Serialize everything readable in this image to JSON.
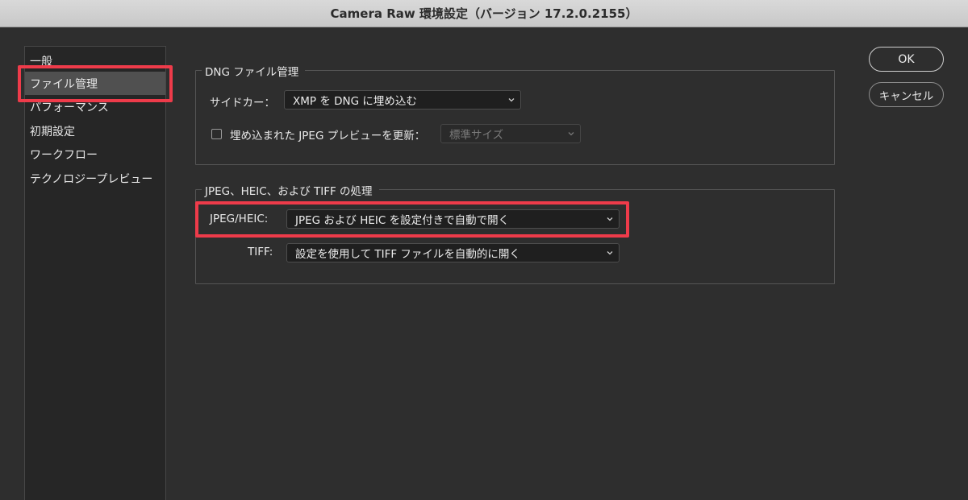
{
  "window": {
    "title": "Camera Raw 環境設定（バージョン 17.2.0.2155）"
  },
  "sidebar": {
    "items": [
      {
        "label": "一般"
      },
      {
        "label": "ファイル管理"
      },
      {
        "label": "パフォーマンス"
      },
      {
        "label": "初期設定"
      },
      {
        "label": "ワークフロー"
      },
      {
        "label": "テクノロジープレビュー"
      }
    ],
    "selected": "ファイル管理"
  },
  "dng": {
    "title": "DNG ファイル管理",
    "sidecar_label": "サイドカー：",
    "sidecar_value": "XMP を DNG に埋め込む",
    "update_preview_label": "埋め込まれた JPEG プレビューを更新：",
    "update_preview_checked": false,
    "preview_size_value": "標準サイズ"
  },
  "jpeg": {
    "title": "JPEG、HEIC、および TIFF の処理",
    "jpeg_heic_label": "JPEG/HEIC:",
    "jpeg_heic_value": "JPEG および HEIC を設定付きで自動で開く",
    "tiff_label": "TIFF:",
    "tiff_value": "設定を使用して TIFF ファイルを自動的に開く"
  },
  "buttons": {
    "ok": "OK",
    "cancel": "キャンセル"
  },
  "colors": {
    "highlight": "#ee3b4a",
    "background": "#2e2e2e",
    "titlebar": "#d0d0d0"
  },
  "icons": {
    "dropdown": "chevron-down-icon"
  }
}
